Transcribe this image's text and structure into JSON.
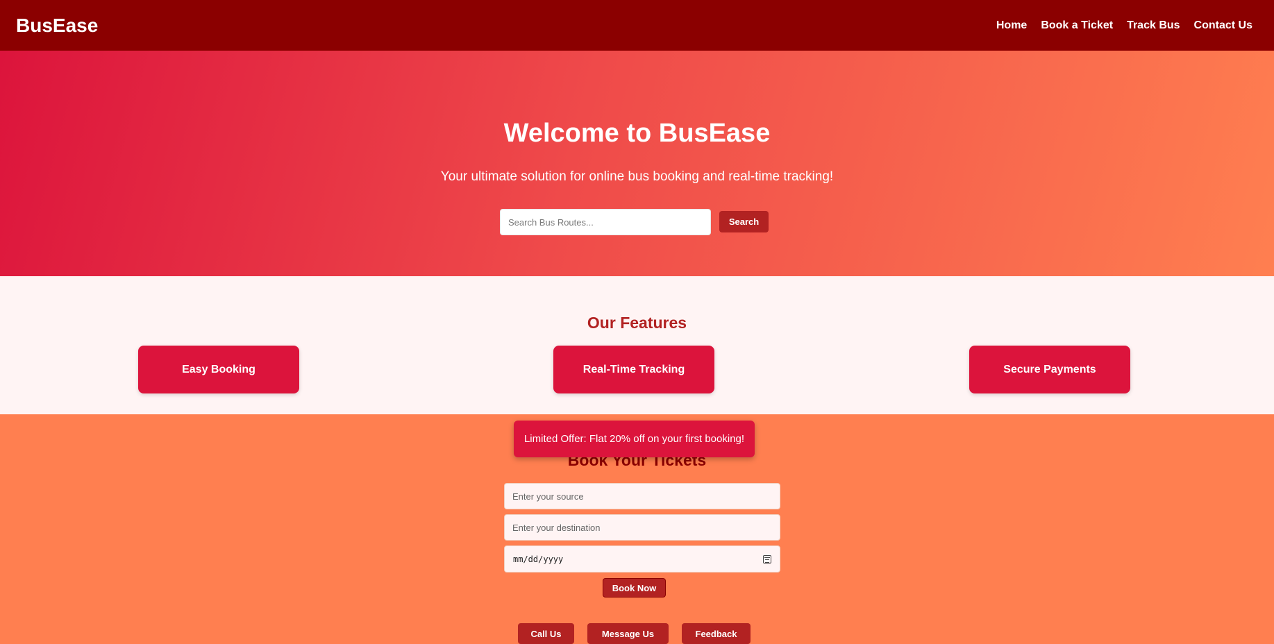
{
  "header": {
    "logo": "BusEase",
    "nav": [
      "Home",
      "Book a Ticket",
      "Track Bus",
      "Contact Us"
    ]
  },
  "hero": {
    "title": "Welcome to BusEase",
    "subtitle": "Your ultimate solution for online bus booking and real-time tracking!",
    "search_placeholder": "Search Bus Routes...",
    "search_button": "Search"
  },
  "features": {
    "title": "Our Features",
    "items": [
      "Easy Booking",
      "Real-Time Tracking",
      "Secure Payments"
    ]
  },
  "booking": {
    "title": "Book Your Tickets",
    "source_placeholder": "Enter your source",
    "destination_placeholder": "Enter your destination",
    "date_placeholder": "mm/dd/yyyy",
    "book_button": "Book Now",
    "contact_buttons": [
      "Call Us",
      "Message Us",
      "Feedback"
    ]
  },
  "offer": {
    "text": "Limited Offer: Flat 20% off on your first booking!"
  },
  "colors": {
    "header_bg": "#8b0000",
    "accent": "#dc143c",
    "button": "#b22222",
    "hero_gradient_end": "#ff7f50",
    "features_bg": "#fff4f4"
  }
}
